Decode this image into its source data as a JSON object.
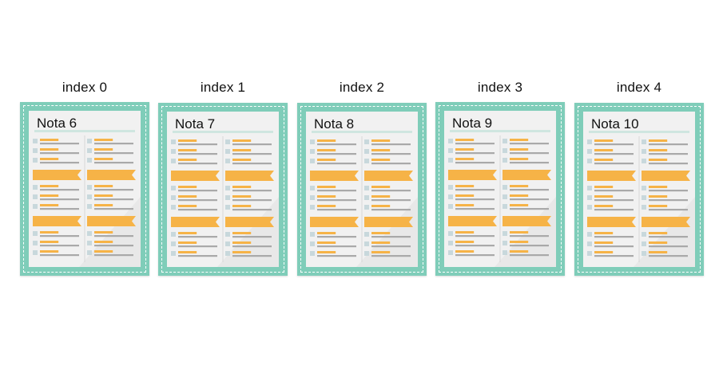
{
  "slots": [
    {
      "index_label": "index 0",
      "nota_title": "Nota 6"
    },
    {
      "index_label": "index 1",
      "nota_title": "Nota 7"
    },
    {
      "index_label": "index 2",
      "nota_title": "Nota 8"
    },
    {
      "index_label": "index 3",
      "nota_title": "Nota 9"
    },
    {
      "index_label": "index 4",
      "nota_title": "Nota 10"
    }
  ],
  "colors": {
    "card_border": "#7fcdb9",
    "page_bg": "#f1f1f1",
    "header_rule": "#cfe6e0",
    "banner": "#f6b347",
    "line_orange": "#f6b347",
    "line_gray": "#a9a9a9",
    "bullet": "#c8d8dc",
    "divider": "#d6d6d6"
  },
  "icons": [
    "note-page-illustration"
  ]
}
